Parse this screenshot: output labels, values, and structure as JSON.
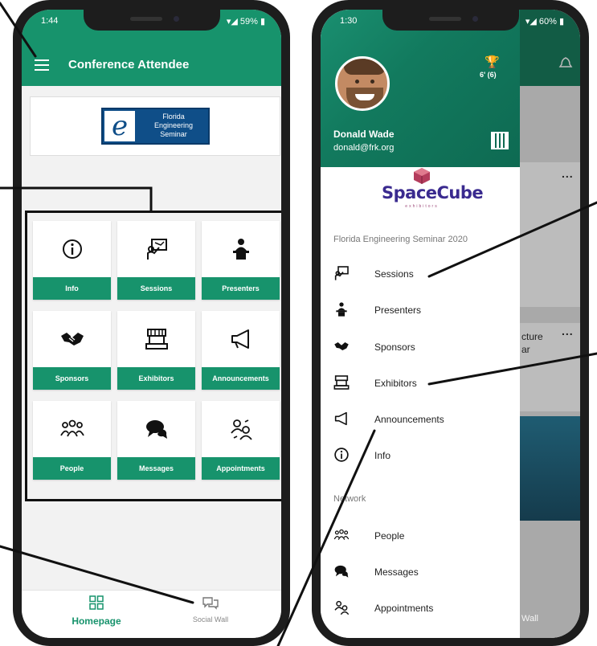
{
  "left_screen": {
    "status_time": "1:44",
    "status_battery": "59%",
    "title": "Conference Attendee",
    "logo": {
      "letter": "e",
      "lines": [
        "Florida",
        "Engineering",
        "Seminar"
      ]
    },
    "tiles": [
      {
        "label": "Info",
        "icon": "info-icon"
      },
      {
        "label": "Sessions",
        "icon": "presentation-icon"
      },
      {
        "label": "Presenters",
        "icon": "presenter-icon"
      },
      {
        "label": "Sponsors",
        "icon": "handshake-icon"
      },
      {
        "label": "Exhibitors",
        "icon": "booth-icon"
      },
      {
        "label": "Announcements",
        "icon": "megaphone-icon"
      },
      {
        "label": "People",
        "icon": "people-icon"
      },
      {
        "label": "Messages",
        "icon": "chat-bubbles-icon"
      },
      {
        "label": "Appointments",
        "icon": "appointments-icon"
      }
    ],
    "bottom_nav": {
      "home": "Homepage",
      "social": "Social Wall"
    }
  },
  "right_screen": {
    "status_time": "1:30",
    "status_battery": "60%",
    "user": {
      "name": "Donald Wade",
      "email": "donald@frk.org",
      "points": "6' (6)"
    },
    "sponsor_logo": {
      "name": "SpaceCube",
      "tagline": "exhibitors"
    },
    "event_section": "Florida Engineering Seminar 2020",
    "event_items": [
      {
        "label": "Sessions",
        "icon": "presentation-icon"
      },
      {
        "label": "Presenters",
        "icon": "presenter-icon"
      },
      {
        "label": "Sponsors",
        "icon": "handshake-icon"
      },
      {
        "label": "Exhibitors",
        "icon": "booth-icon"
      },
      {
        "label": "Announcements",
        "icon": "megaphone-icon"
      },
      {
        "label": "Info",
        "icon": "info-icon"
      }
    ],
    "network_section": "Network",
    "network_items": [
      {
        "label": "People",
        "icon": "people-icon"
      },
      {
        "label": "Messages",
        "icon": "chat-bubbles-icon"
      },
      {
        "label": "Appointments",
        "icon": "appointments-icon"
      }
    ],
    "background": {
      "text1": "cture",
      "text2": "ar",
      "dots": "...",
      "wall": "Wall"
    }
  }
}
